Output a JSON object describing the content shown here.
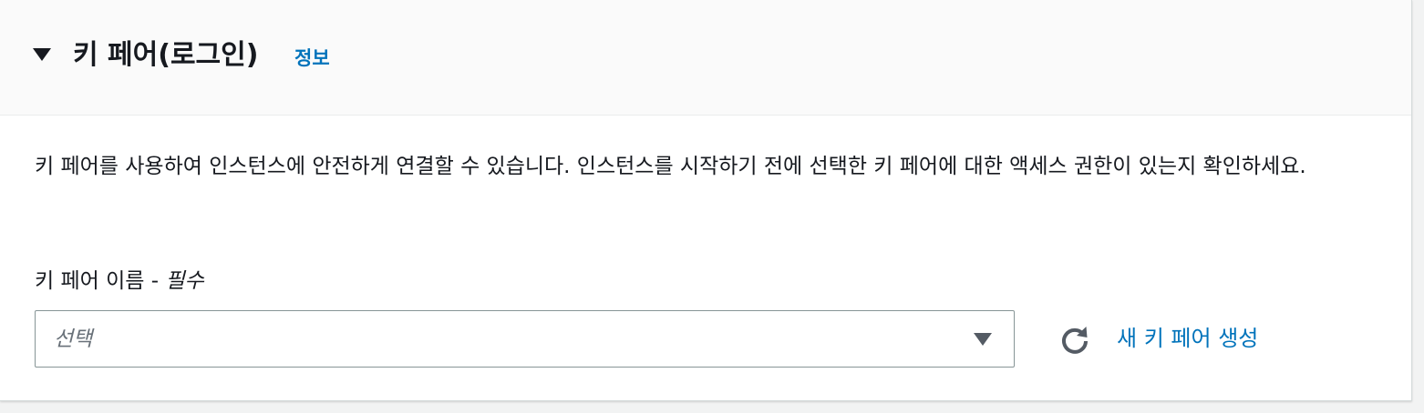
{
  "section": {
    "title": "키 페어(로그인)",
    "info_link": "정보",
    "description": "키 페어를 사용하여 인스턴스에 안전하게 연결할 수 있습니다. 인스턴스를 시작하기 전에 선택한 키 페어에 대한 액세스 권한이 있는지 확인하세요."
  },
  "key_pair_field": {
    "label": "키 페어 이름 - ",
    "required_text": "필수",
    "placeholder": "선택"
  },
  "create_link": "새 키 페어 생성",
  "icons": {
    "expand": "caret-down-icon",
    "dropdown": "caret-down-icon",
    "refresh": "refresh-icon"
  },
  "colors": {
    "link": "#0073bb",
    "text": "#16191f",
    "placeholder": "#687078",
    "border": "#879596"
  }
}
